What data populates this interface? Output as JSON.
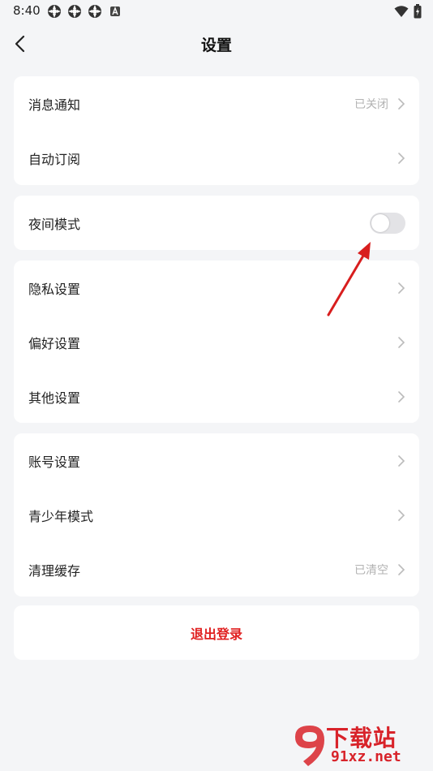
{
  "status_bar": {
    "time": "8:40",
    "icons": [
      "app-notification-icon",
      "app-notification-icon",
      "app-notification-icon",
      "a-badge-icon"
    ],
    "right_icons": [
      "wifi-icon",
      "battery-charging-icon"
    ]
  },
  "nav": {
    "title": "设置",
    "back_icon": "chevron-left-icon"
  },
  "groups": [
    {
      "items": [
        {
          "label": "消息通知",
          "value": "已关闭"
        },
        {
          "label": "自动订阅",
          "value": ""
        }
      ]
    },
    {
      "items": [
        {
          "label": "夜间模式",
          "toggle": true,
          "toggle_on": false
        }
      ]
    },
    {
      "items": [
        {
          "label": "隐私设置",
          "value": ""
        },
        {
          "label": "偏好设置",
          "value": ""
        },
        {
          "label": "其他设置",
          "value": ""
        }
      ]
    },
    {
      "items": [
        {
          "label": "账号设置",
          "value": ""
        },
        {
          "label": "青少年模式",
          "value": ""
        },
        {
          "label": "清理缓存",
          "value": "已清空"
        }
      ]
    }
  ],
  "logout": {
    "label": "退出登录"
  },
  "watermark": {
    "main": "下载站",
    "sub": "91xz.net"
  },
  "colors": {
    "background": "#f4f5f7",
    "card": "#ffffff",
    "logout": "#e02020",
    "arrow": "#d81e1e",
    "muted": "#b3b3b3"
  }
}
